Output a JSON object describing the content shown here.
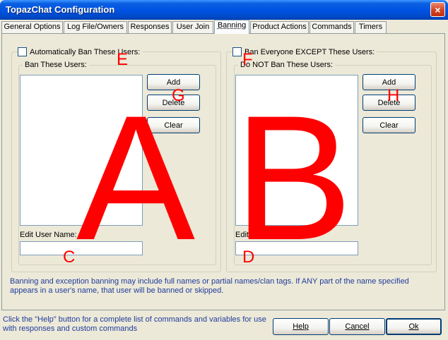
{
  "window": {
    "title": "TopazChat Configuration",
    "close_glyph": "×"
  },
  "tabs": [
    {
      "label": "General Options"
    },
    {
      "label": "Log File/Owners"
    },
    {
      "label": "Responses"
    },
    {
      "label": "User Join"
    },
    {
      "label": "Banning",
      "active": true
    },
    {
      "label": "Product Actions"
    },
    {
      "label": "Commands"
    },
    {
      "label": "Timers"
    }
  ],
  "left_group": {
    "checkbox_label": "Automatically Ban These Users:",
    "list_label": "Ban These Users:",
    "edit_label": "Edit User Name:",
    "edit_value": "",
    "buttons": {
      "add": "Add",
      "delete": "Delete",
      "clear": "Clear"
    }
  },
  "right_group": {
    "checkbox_label": "Ban Everyone EXCEPT These Users:",
    "list_label": "Do NOT Ban These Users:",
    "edit_label": "Edit User Name:",
    "edit_value": "",
    "buttons": {
      "add": "Add",
      "delete": "Delete",
      "clear": "Clear"
    }
  },
  "info_text": "Banning and exception banning may include full names or partial names/clan tags.  If ANY part of the name specified appears in a user's name, that user will be banned or skipped.",
  "footer": {
    "note": "Click the \"Help\" button for a complete list of commands and variables for use with responses and custom commands",
    "help": "Help",
    "cancel": "Cancel",
    "ok": "Ok"
  },
  "annotations": {
    "A": "A",
    "B": "B",
    "C": "C",
    "D": "D",
    "E": "E",
    "F": "F",
    "G": "G",
    "H": "H",
    "color": "#ff0000"
  }
}
